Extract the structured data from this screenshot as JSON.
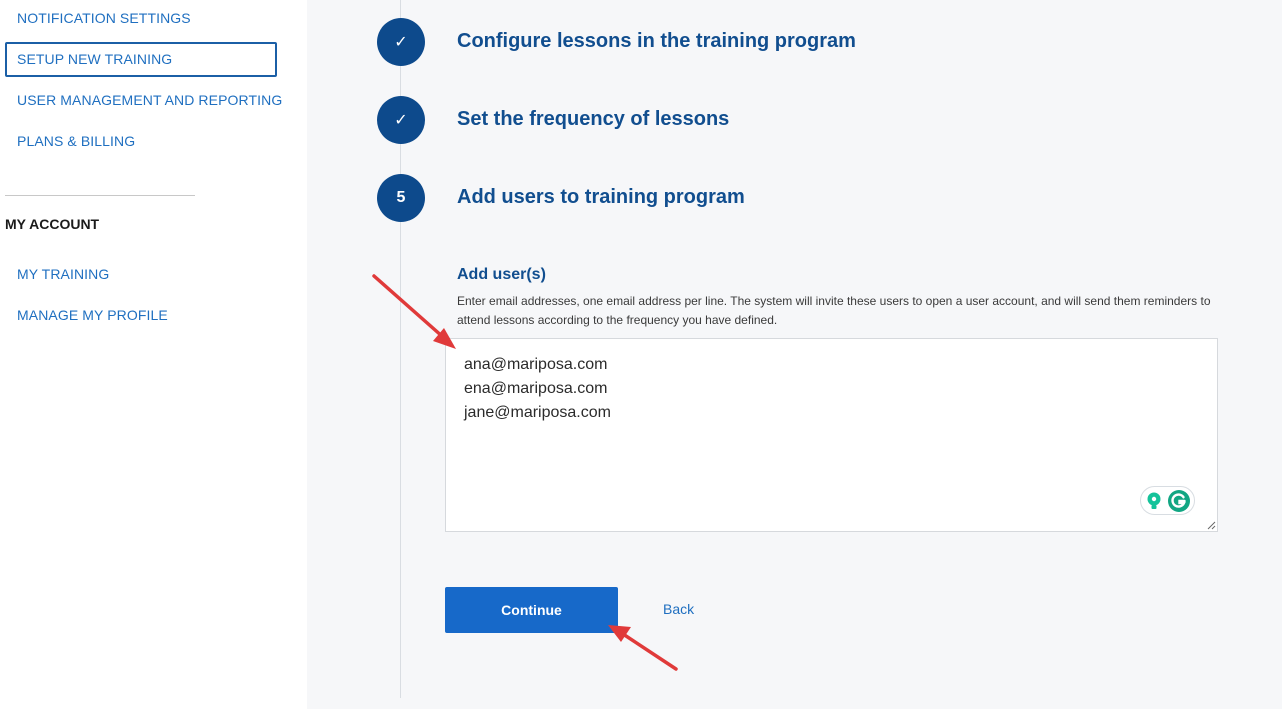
{
  "sidebar": {
    "items": [
      {
        "label": "NOTIFICATION SETTINGS"
      },
      {
        "label": "SETUP NEW TRAINING"
      },
      {
        "label": "USER MANAGEMENT AND REPORTING"
      },
      {
        "label": "PLANS & BILLING"
      }
    ],
    "account_title": "MY ACCOUNT",
    "account_items": [
      {
        "label": "MY TRAINING"
      },
      {
        "label": "MANAGE MY PROFILE"
      }
    ]
  },
  "steps": [
    {
      "marker": "✓",
      "title": "Configure lessons in the training program"
    },
    {
      "marker": "✓",
      "title": "Set the frequency of lessons"
    },
    {
      "marker": "5",
      "title": "Add users to training program"
    }
  ],
  "form": {
    "label": "Add user(s)",
    "help": "Enter email addresses, one email address per line. The system will invite these users to open a user account, and will send them reminders to attend lessons according to the frequency you have defined.",
    "emails": "ana@mariposa.com\nena@mariposa.com\njane@mariposa.com",
    "continue_label": "Continue",
    "back_label": "Back"
  },
  "colors": {
    "accent": "#1769c9",
    "step_circle": "#0d4a8c",
    "annotation_arrow": "#e03a3a"
  },
  "icons": {
    "grammarly_bulb": "lightbulb-icon",
    "grammarly_logo": "grammarly-icon"
  }
}
